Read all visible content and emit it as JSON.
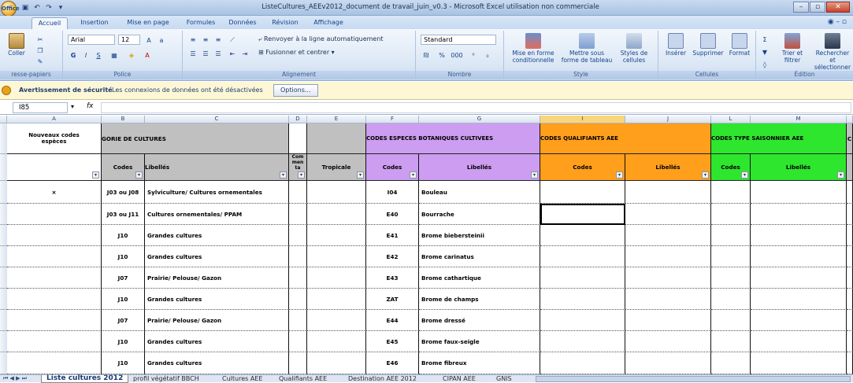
{
  "window": {
    "title": "ListeCultures_AEEv2012_document de travail_juin_v0.3 - Microsoft Excel utilisation non commerciale",
    "office_button": "Office"
  },
  "ribbon_tabs": [
    "Accueil",
    "Insertion",
    "Mise en page",
    "Formules",
    "Données",
    "Révision",
    "Affichage"
  ],
  "ribbon": {
    "clipboard": {
      "paste": "Coller",
      "label": "resse-papiers"
    },
    "font": {
      "name": "Arial",
      "size": "12",
      "bold": "G",
      "italic": "I",
      "underline": "S",
      "label": "Police"
    },
    "alignment": {
      "wrap": "Renvoyer à la ligne automatiquement",
      "merge": "Fusionner et centrer",
      "label": "Alignement"
    },
    "number": {
      "format": "Standard",
      "percent": "%",
      "thousands": "000",
      "label": "Nombre"
    },
    "style": {
      "cond": "Mise en forme conditionnelle",
      "table": "Mettre sous forme de tableau",
      "cellstyles": "Styles de cellules",
      "label": "Style"
    },
    "cells": {
      "insert": "Insérer",
      "delete": "Supprimer",
      "format": "Format",
      "label": "Cellules"
    },
    "editing": {
      "sort": "Trier et filtrer",
      "find": "Rechercher et sélectionner",
      "label": "Édition"
    }
  },
  "security_bar": {
    "title": "Avertissement de sécurité",
    "message": "Les connexions de données ont été désactivées",
    "options": "Options..."
  },
  "formula": {
    "namebox": "I85",
    "fx": "fx",
    "value": ""
  },
  "columns": [
    "A",
    "B",
    "C",
    "D",
    "E",
    "F",
    "G",
    "I",
    "J",
    "L",
    "M"
  ],
  "header": {
    "a": "Nouveaux codes espèces",
    "bc": "GORIE DE CULTURES",
    "d": "Com men ta",
    "e": "Tropicale",
    "fg": "CODES ESPECES BOTANIQUES CULTIVEES",
    "ij": "CODES QUALIFIANTS AEE",
    "lm": "CODES TYPE SAISONNIER AEE",
    "n": "C",
    "codes": "Codes",
    "libelles": "Libellés",
    "libelles2": "Libellés"
  },
  "rows": [
    {
      "a": "×",
      "b": "J03 ou J08",
      "c": "Sylviculture/ Cultures ornementales",
      "f": "I04",
      "g": "Bouleau"
    },
    {
      "a": "",
      "b": "J03 ou J11",
      "c": "Cultures ornementales/ PPAM",
      "f": "E40",
      "g": "Bourrache"
    },
    {
      "a": "",
      "b": "J10",
      "c": "Grandes cultures",
      "f": "E41",
      "g": "Brome biebersteinii"
    },
    {
      "a": "",
      "b": "J10",
      "c": "Grandes cultures",
      "f": "E42",
      "g": "Brome carinatus"
    },
    {
      "a": "",
      "b": "J07",
      "c": "Prairie/ Pelouse/ Gazon",
      "f": "E43",
      "g": "Brome cathartique"
    },
    {
      "a": "",
      "b": "J10",
      "c": "Grandes cultures",
      "f": "ZAT",
      "g": "Brome de champs"
    },
    {
      "a": "",
      "b": "J07",
      "c": "Prairie/ Pelouse/ Gazon",
      "f": "E44",
      "g": "Brome dressé"
    },
    {
      "a": "",
      "b": "J10",
      "c": "Grandes cultures",
      "f": "E45",
      "g": "Brome faux-seigle"
    },
    {
      "a": "",
      "b": "J10",
      "c": "Grandes cultures",
      "f": "E46",
      "g": "Brome fibreux"
    }
  ],
  "sheet_tabs": [
    "Liste cultures 2012",
    "profil végétatif BBCH",
    "Cultures AEE",
    "Qualifiants AEE",
    "Destination AEE 2012",
    "CIPAN AEE",
    "GNIS"
  ],
  "colors": {
    "purple": "#cc9df0",
    "orange": "#ff9f1c",
    "green": "#2ee62e",
    "gray": "#c0c0c0"
  }
}
